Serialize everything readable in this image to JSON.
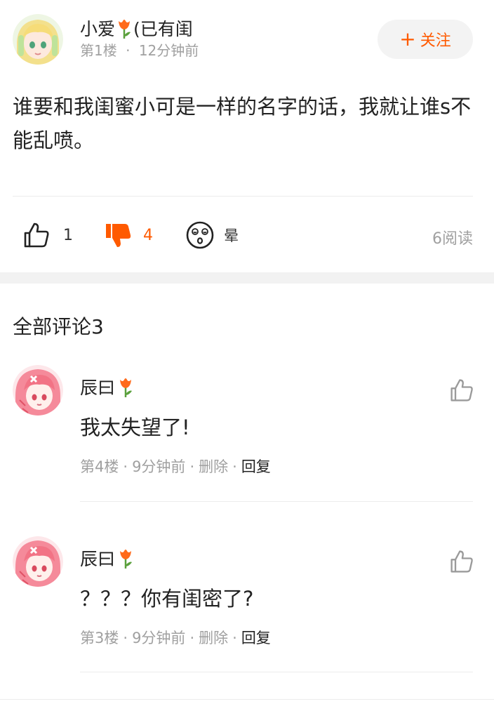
{
  "post": {
    "author_name": "小爱",
    "author_tag": "(已有闺",
    "floor": "第1楼",
    "dot": "·",
    "time": "12分钟前",
    "follow_label": "关注",
    "follow_plus": "+",
    "content": "谁要和我闺蜜小可是一样的名字的话，我就让谁s不能乱喷。"
  },
  "actions": {
    "like_count": "1",
    "dislike_count": "4",
    "dizzy_label": "晕",
    "read_count": "6阅读"
  },
  "colors": {
    "accent": "#ff5a00",
    "meta_gray": "#a0a0a0",
    "section_gap": "#f2f2f2"
  },
  "comments_section": {
    "title": "全部评论3",
    "items": [
      {
        "name": "辰曰",
        "text": "我太失望了!",
        "floor": "第4楼",
        "time": "9分钟前",
        "delete_label": "删除",
        "reply_label": "回复",
        "dot": "·"
      },
      {
        "name": "辰曰",
        "text": "？？？你有闺密了?",
        "floor": "第3楼",
        "time": "9分钟前",
        "delete_label": "删除",
        "reply_label": "回复",
        "dot": "·"
      }
    ]
  },
  "icons": {
    "tulip": "tulip-icon",
    "like": "thumbs-up-icon",
    "dislike": "thumbs-down-icon",
    "dizzy": "dizzy-face-icon"
  }
}
